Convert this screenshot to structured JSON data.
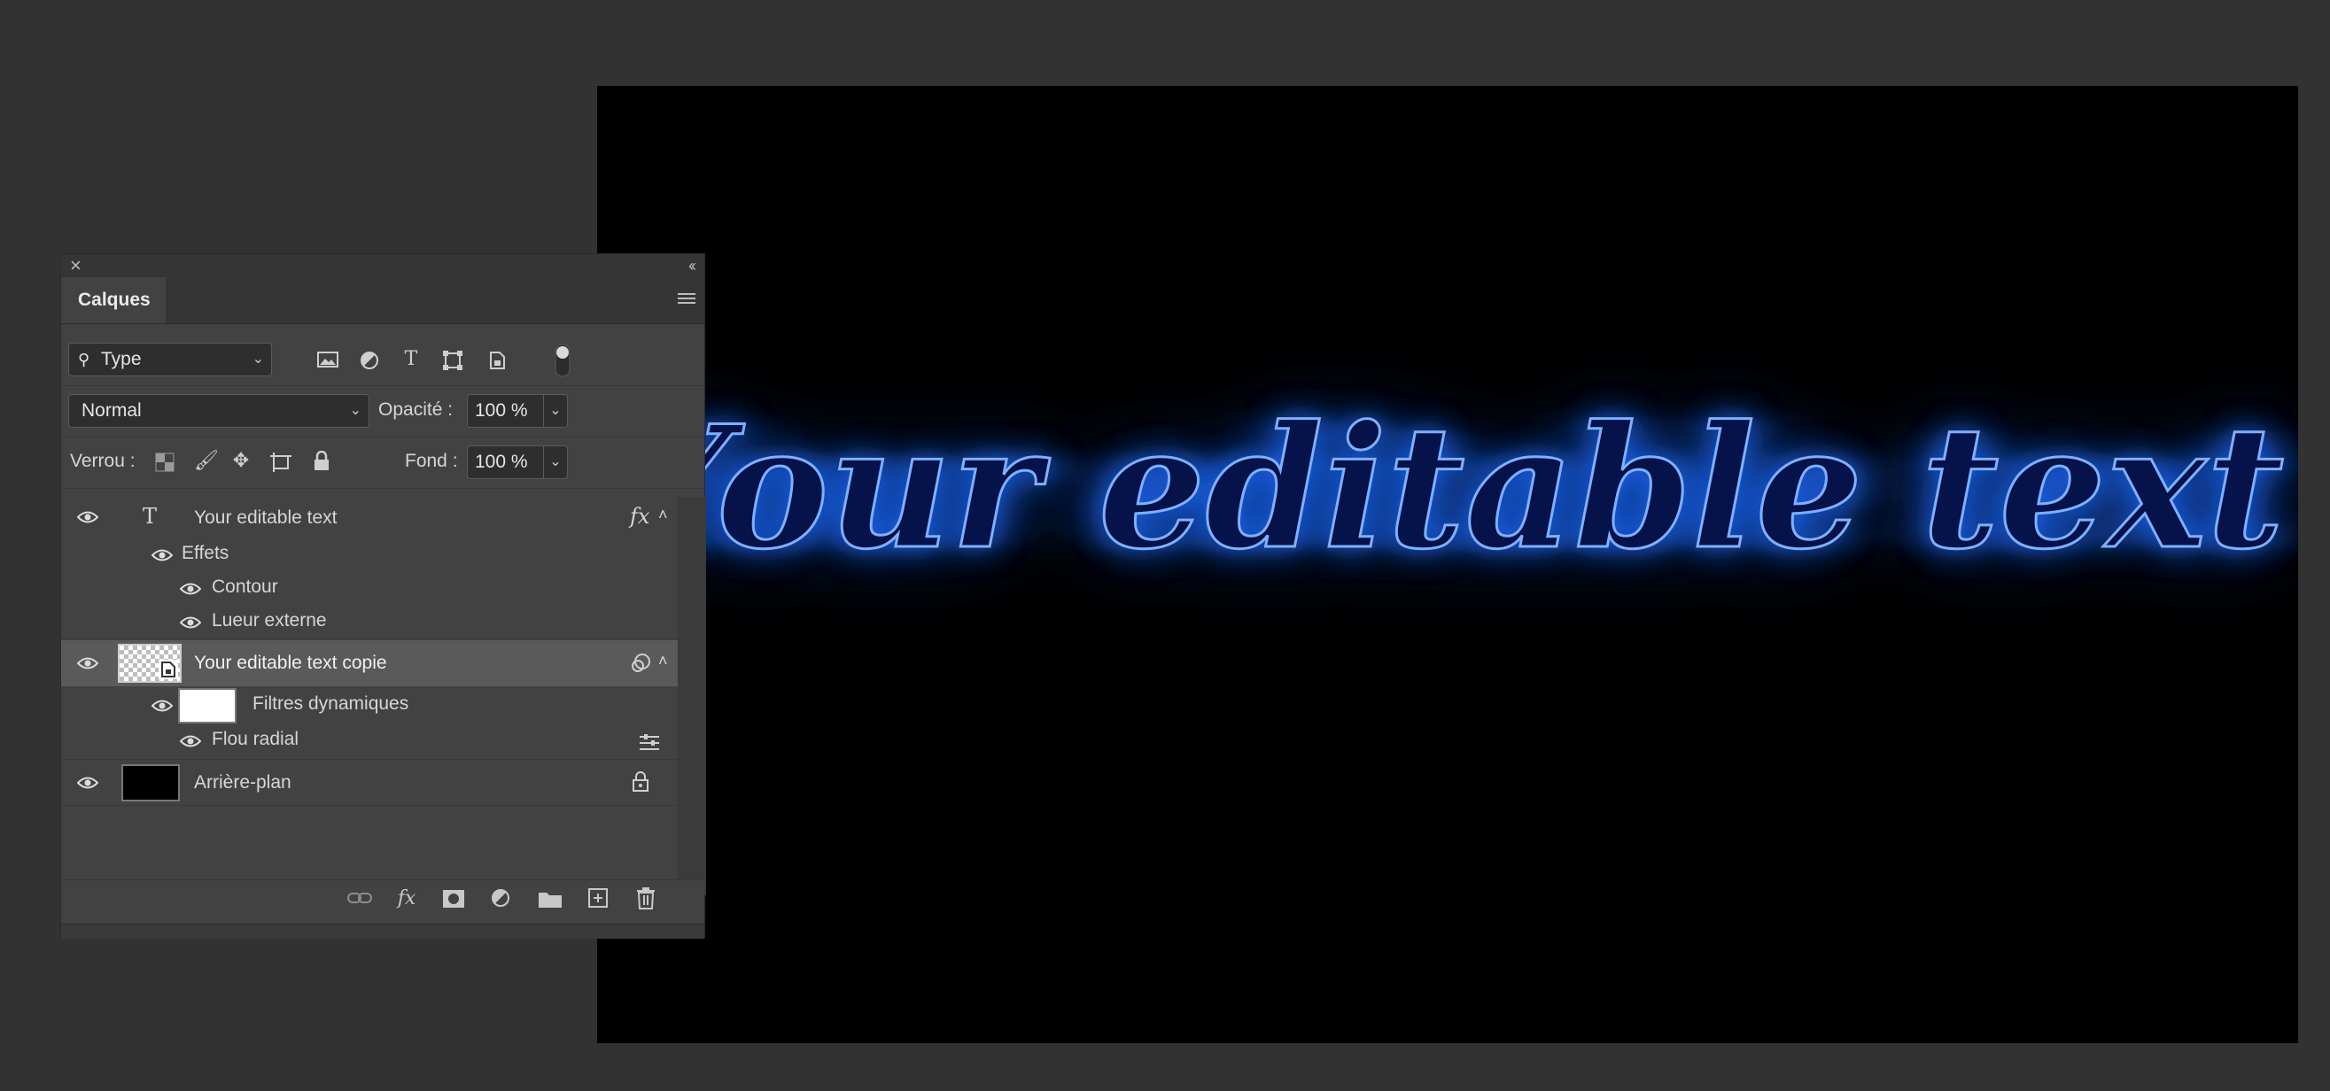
{
  "canvas": {
    "text": "Your editable text",
    "background": "#000000",
    "glow_color": "#1e6bff",
    "text_fill": "#06124a",
    "stroke_color": "#7fb0ff"
  },
  "panel": {
    "tab": "Calques",
    "filter": {
      "label": "Type",
      "icons": [
        "image-icon",
        "adjustment-icon",
        "type-icon",
        "shape-icon",
        "smart-object-icon"
      ]
    },
    "blend_mode": "Normal",
    "opacity": {
      "label": "Opacité :",
      "value": "100 %"
    },
    "lock": {
      "label": "Verrou :"
    },
    "fill": {
      "label": "Fond :",
      "value": "100 %"
    },
    "layers": [
      {
        "name": "Your editable text",
        "kind": "text",
        "fx": "fx"
      },
      {
        "name": "Effets"
      },
      {
        "name": "Contour"
      },
      {
        "name": "Lueur externe"
      },
      {
        "name": "Your editable text copie",
        "kind": "smart-object",
        "selected": true
      },
      {
        "name": "Filtres dynamiques"
      },
      {
        "name": "Flou radial"
      },
      {
        "name": "Arrière-plan",
        "kind": "background",
        "locked": true
      }
    ],
    "bottom_icons": [
      "link-icon",
      "fx-icon",
      "mask-icon",
      "adjustment-icon",
      "folder-icon",
      "new-layer-icon",
      "trash-icon"
    ]
  }
}
